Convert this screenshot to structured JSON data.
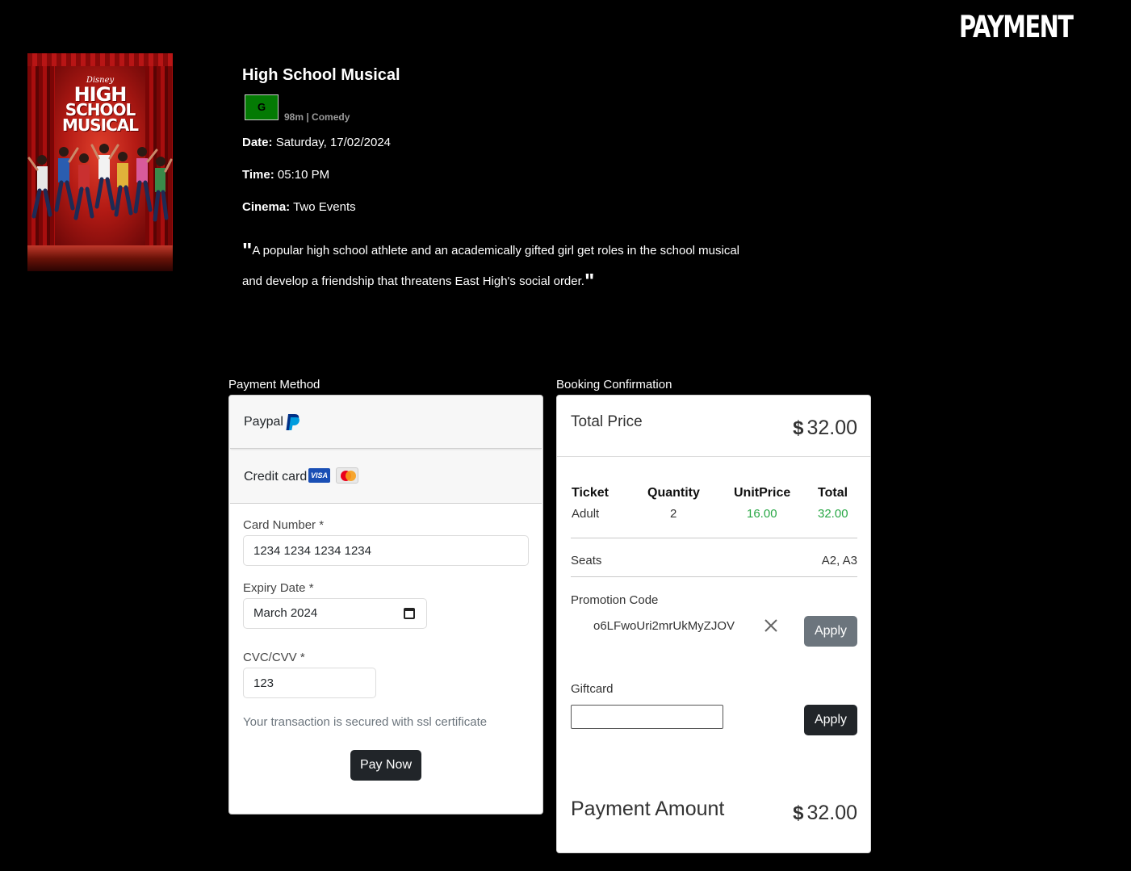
{
  "page": {
    "heading": "PAYMENT"
  },
  "poster": {
    "brand": "Disney",
    "logo_line1": "HIGH",
    "logo_line2": "SCHOOL",
    "logo_line3": "MUSICAL"
  },
  "movie": {
    "title": "High School Musical",
    "rating": "G",
    "meta": "98m | Comedy",
    "date_label": "Date:",
    "date_value": "Saturday, 17/02/2024",
    "time_label": "Time:",
    "time_value": "05:10 PM",
    "cinema_label": "Cinema:",
    "cinema_value": "Two Events",
    "synopsis": "A popular high school athlete and an academically gifted girl get roles in the school musical and develop a friendship that threatens East High's social order.",
    "quote_mark": "\""
  },
  "payment_method": {
    "section_label": "Payment Method",
    "paypal_label": "Paypal",
    "credit_label": "Credit card",
    "visa_text": "VISA",
    "card_number_label": "Card Number *",
    "card_number_value": "1234 1234 1234 1234",
    "expiry_label": "Expiry Date *",
    "expiry_value": "March 2024",
    "cvc_label": "CVC/CVV *",
    "cvc_value": "123",
    "secure_note": "Your transaction is secured with ssl certificate",
    "pay_button": "Pay Now"
  },
  "booking": {
    "section_label": "Booking Confirmation",
    "total_price_label": "Total Price",
    "currency": "$",
    "total_price_value": "32.00",
    "table": {
      "headers": [
        "Ticket",
        "Quantity",
        "UnitPrice",
        "Total"
      ],
      "rows": [
        [
          "Adult",
          "2",
          "16.00",
          "32.00"
        ]
      ]
    },
    "seats_label": "Seats",
    "seats_value": "A2, A3",
    "promo_label": "Promotion Code",
    "promo_value": "o6LFwoUri2mrUkMyZJOV",
    "promo_apply": "Apply",
    "giftcard_label": "Giftcard",
    "giftcard_value": "",
    "giftcard_apply": "Apply",
    "payment_amount_label": "Payment Amount",
    "payment_amount_value": "32.00"
  },
  "colors": {
    "rating_badge": "#047a04",
    "price_green": "#28a745",
    "button_dark": "#212529",
    "button_grey": "#6c757d"
  }
}
